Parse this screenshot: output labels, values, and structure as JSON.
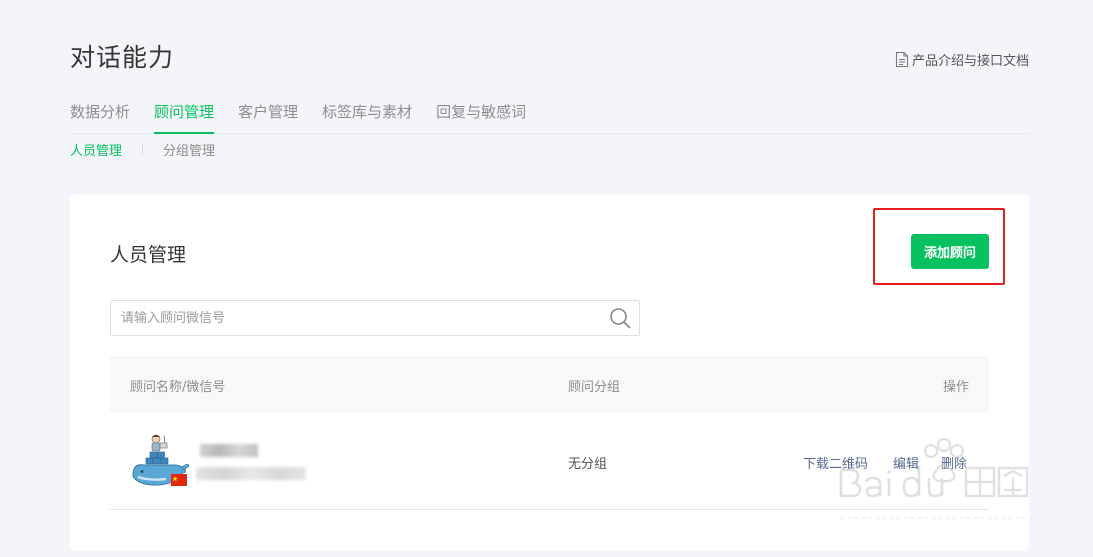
{
  "header": {
    "title": "对话能力",
    "doc_link": "产品介绍与接口文档"
  },
  "main_tabs": [
    {
      "label": "数据分析"
    },
    {
      "label": "顾问管理"
    },
    {
      "label": "客户管理"
    },
    {
      "label": "标签库与素材"
    },
    {
      "label": "回复与敏感词"
    }
  ],
  "active_main_tab": "顾问管理",
  "sub_tabs": [
    {
      "label": "人员管理"
    },
    {
      "label": "分组管理"
    }
  ],
  "active_sub_tab": "人员管理",
  "card": {
    "title": "人员管理",
    "add_button": "添加顾问"
  },
  "search": {
    "value": "",
    "placeholder": "请输入顾问微信号"
  },
  "table": {
    "columns": [
      "顾问名称/微信号",
      "顾问分组",
      "操作"
    ],
    "rows": [
      {
        "group": "无分组",
        "actions": [
          "下载二维码",
          "编辑",
          "删除"
        ]
      }
    ]
  },
  "colors": {
    "accent": "#07c160",
    "link": "#576b95",
    "highlight": "#e02020"
  },
  "icons": [
    "document-icon",
    "search-icon",
    "avatar"
  ]
}
